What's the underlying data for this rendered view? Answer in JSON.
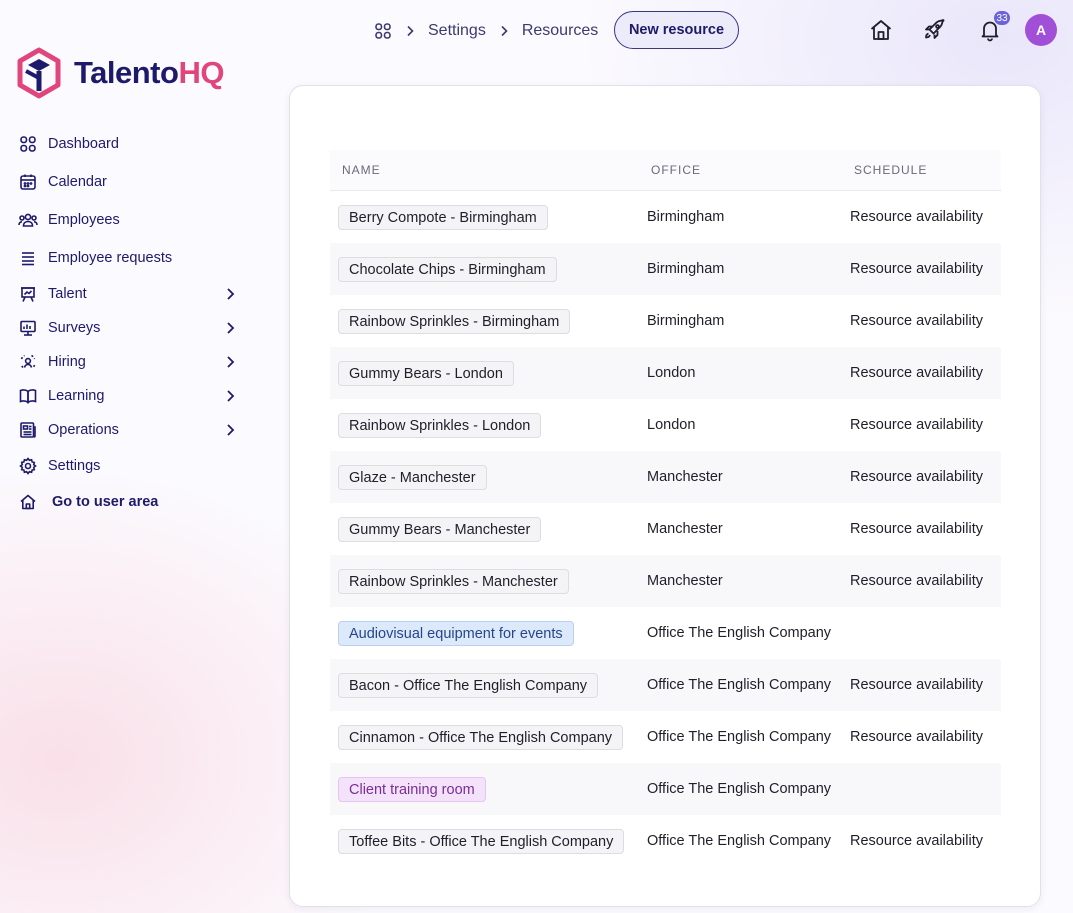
{
  "brand": {
    "name_part1": "Talento",
    "name_part2": "HQ",
    "color_dark": "#1e1a6b",
    "color_accent": "#e0457b"
  },
  "sidebar": {
    "items": [
      {
        "label": "Dashboard",
        "icon": "dashboard-icon",
        "has_children": false
      },
      {
        "label": "Calendar",
        "icon": "calendar-icon",
        "has_children": false
      },
      {
        "label": "Employees",
        "icon": "employees-icon",
        "has_children": false
      },
      {
        "label": "Employee requests",
        "icon": "requests-icon",
        "has_children": false
      },
      {
        "label": "Talent",
        "icon": "talent-icon",
        "has_children": true
      },
      {
        "label": "Surveys",
        "icon": "surveys-icon",
        "has_children": true
      },
      {
        "label": "Hiring",
        "icon": "hiring-icon",
        "has_children": true
      },
      {
        "label": "Learning",
        "icon": "book-icon",
        "has_children": true
      },
      {
        "label": "Operations",
        "icon": "operations-icon",
        "has_children": true
      },
      {
        "label": "Settings",
        "icon": "gear-icon",
        "has_children": false
      },
      {
        "label": "Go to user area",
        "icon": "home-icon",
        "has_children": false
      }
    ]
  },
  "header": {
    "breadcrumb": [
      "Settings",
      "Resources"
    ],
    "new_button": "New resource",
    "notification_count": "33",
    "avatar_initial": "A"
  },
  "table": {
    "columns": [
      "NAME",
      "OFFICE",
      "SCHEDULE"
    ],
    "rows": [
      {
        "name": "Berry Compote - Birmingham",
        "office": "Birmingham",
        "schedule": "Resource availability",
        "tag": "default"
      },
      {
        "name": "Chocolate Chips - Birmingham",
        "office": "Birmingham",
        "schedule": "Resource availability",
        "tag": "default"
      },
      {
        "name": "Rainbow Sprinkles - Birmingham",
        "office": "Birmingham",
        "schedule": "Resource availability",
        "tag": "default"
      },
      {
        "name": "Gummy Bears - London",
        "office": "London",
        "schedule": "Resource availability",
        "tag": "default"
      },
      {
        "name": "Rainbow Sprinkles - London",
        "office": "London",
        "schedule": "Resource availability",
        "tag": "default"
      },
      {
        "name": "Glaze - Manchester",
        "office": "Manchester",
        "schedule": "Resource availability",
        "tag": "default"
      },
      {
        "name": "Gummy Bears - Manchester",
        "office": "Manchester",
        "schedule": "Resource availability",
        "tag": "default"
      },
      {
        "name": "Rainbow Sprinkles - Manchester",
        "office": "Manchester",
        "schedule": "Resource availability",
        "tag": "default"
      },
      {
        "name": "Audiovisual equipment for events",
        "office": "Office The English Company",
        "schedule": "",
        "tag": "blue"
      },
      {
        "name": "Bacon - Office The English Company",
        "office": "Office The English Company",
        "schedule": "Resource availability",
        "tag": "default"
      },
      {
        "name": "Cinnamon - Office The English Company",
        "office": "Office The English Company",
        "schedule": "Resource availability",
        "tag": "default"
      },
      {
        "name": "Client training room",
        "office": "Office The English Company",
        "schedule": "",
        "tag": "purple"
      },
      {
        "name": "Toffee Bits - Office The English Company",
        "office": "Office The English Company",
        "schedule": "Resource availability",
        "tag": "default"
      }
    ]
  }
}
